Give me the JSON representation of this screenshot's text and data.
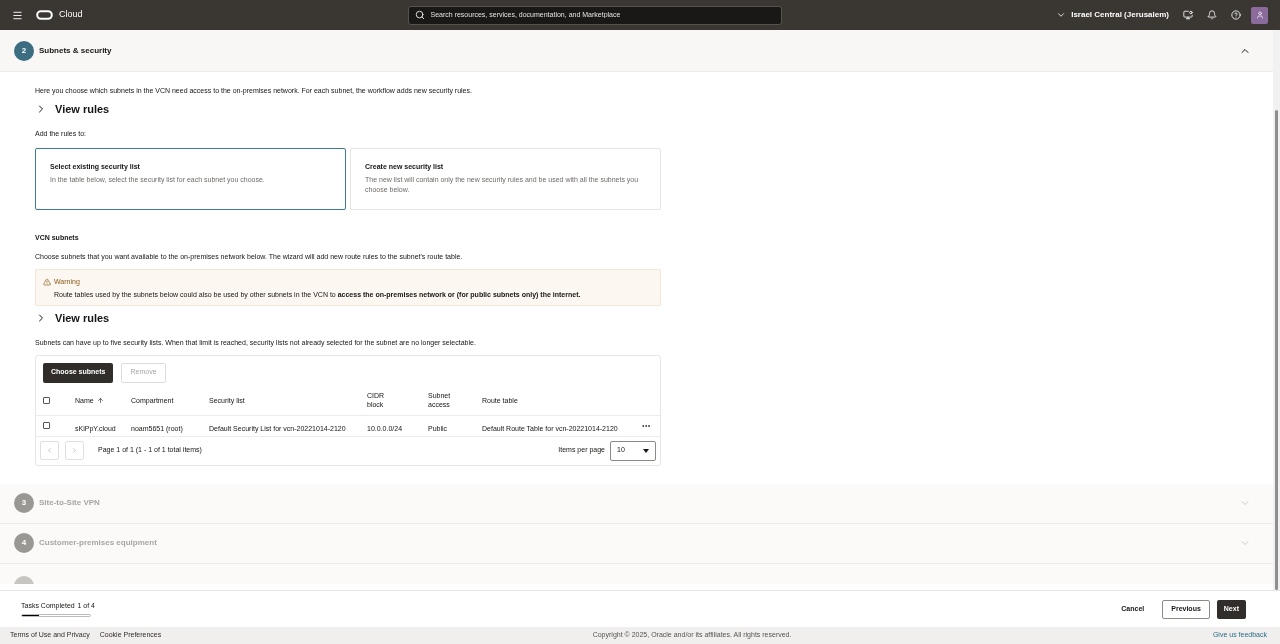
{
  "header": {
    "title": "Cloud",
    "search_placeholder": "Search resources, services, documentation, and Marketplace",
    "region": "Israel Central (Jerusalem)"
  },
  "steps": [
    {
      "number": "2",
      "title": "Subnets & security",
      "expanded": true,
      "disabled": false
    },
    {
      "number": "3",
      "title": "Site-to-Site VPN",
      "expanded": false,
      "disabled": true
    },
    {
      "number": "4",
      "title": "Customer-premises equipment",
      "expanded": false,
      "disabled": true
    }
  ],
  "section": {
    "intro": "Here you choose which subnets in the VCN need access to the on-premises network. For each subnet, the workflow adds new security rules.",
    "view_rules": "View rules",
    "add_rules_label": "Add the rules to:",
    "options": [
      {
        "title": "Select existing security list",
        "description": "In the table below, select the security list for each subnet you choose.",
        "selected": true
      },
      {
        "title": "Create new security list",
        "description": "The new list will contain only the new security rules and be used with all the subnets you choose below.",
        "selected": false
      }
    ],
    "subnets_heading": "VCN subnets",
    "subnets_description": "Choose subnets that you want available to the on-premises network below. The wizard will add new route rules to the subnet's route table.",
    "warning": {
      "title": "Warning",
      "text": "Route tables used by the subnets below could also be used by other subnets in the VCN to **access the on-premises network or (for public subnets only) the internet.**"
    },
    "view_rules_2": "View rules",
    "limit_text": "Subnets can have up to five security lists. When that limit is reached, security lists not already selected for the subnet are no longer selectable.",
    "table": {
      "buttons": [
        {
          "label": "Choose subnets",
          "disabled": false
        },
        {
          "label": "Remove",
          "disabled": true
        }
      ],
      "all_checked": false,
      "columns": [
        "Name",
        "Compartment",
        "Security list",
        "CIDR block",
        "Subnet access",
        "Route table"
      ],
      "rows": [
        {
          "checked": false,
          "cells": [
            "sKiPpY.cloud",
            "noam5651 (root)",
            "Default Security List for vcn-20221014-2120",
            "10.0.0.0/24",
            "Public",
            "Default Route Table for vcn-20221014-2120"
          ]
        }
      ],
      "pagination": "Page 1 of 1 (1 - 1 of 1 total items)",
      "items_per_page_label": "Items per page",
      "items_per_page": "10"
    }
  },
  "progress": {
    "label": "Tasks Completed",
    "count": "1 of 4",
    "level": 0.25
  },
  "actions": [
    {
      "label": "Cancel",
      "kind": "link"
    },
    {
      "label": "Previous",
      "kind": "outline"
    },
    {
      "label": "Next",
      "kind": "primary"
    }
  ],
  "footer": {
    "links": [
      "Terms of Use and Privacy",
      "Cookie Preferences"
    ],
    "copyright": "Copyright © 2025, Oracle and/or its affiliates. All rights reserved.",
    "feedback": "Give us feedback"
  }
}
